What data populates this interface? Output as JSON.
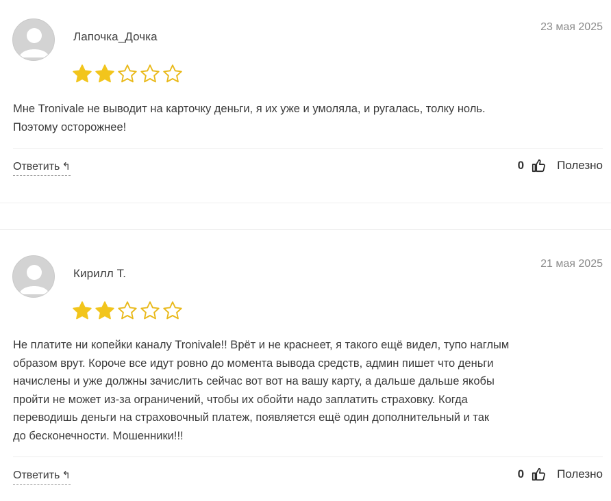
{
  "reviews": [
    {
      "author": "Лапочка_Дочка",
      "date": "23 мая 2025",
      "rating": 2,
      "max_rating": 5,
      "text_lines": [
        "Мне Tronivale не выводит на карточку деньги, я их уже и умоляла, и ругалась, толку ноль.",
        "Поэтому осторожнее!"
      ],
      "reply_label": "Ответить",
      "reply_icon": "reply-arrow-icon",
      "useful_count": "0",
      "useful_label": "Полезно",
      "useful_icon": "thumbs-up-icon"
    },
    {
      "author": "Кирилл Т.",
      "date": "21 мая 2025",
      "rating": 2,
      "max_rating": 5,
      "text_lines": [
        "Не платите ни копейки каналу Tronivale!! Врёт и не краснеет, я такого ещё видел, тупо наглым",
        "образом врут. Короче все идут ровно до момента вывода средств, админ пишет что деньги",
        "начислены и уже должны зачислить сейчас вот вот на вашу карту, а дальше дальше якобы",
        "пройти не может из-за ограничений, чтобы их обойти надо заплатить страховку. Когда",
        "переводишь деньги на страховочный платеж, появляется ещё один дополнительный и так",
        "до бесконечности. Мошенники!!!"
      ],
      "reply_label": "Ответить",
      "reply_icon": "reply-arrow-icon",
      "useful_count": "0",
      "useful_label": "Полезно",
      "useful_icon": "thumbs-up-icon"
    }
  ],
  "colors": {
    "star_filled": "#f2c51c",
    "star_empty_stroke": "#e9b91a",
    "avatar_bg": "#d3d3d3",
    "avatar_fg": "#ffffff",
    "date": "#8c8c8c"
  }
}
